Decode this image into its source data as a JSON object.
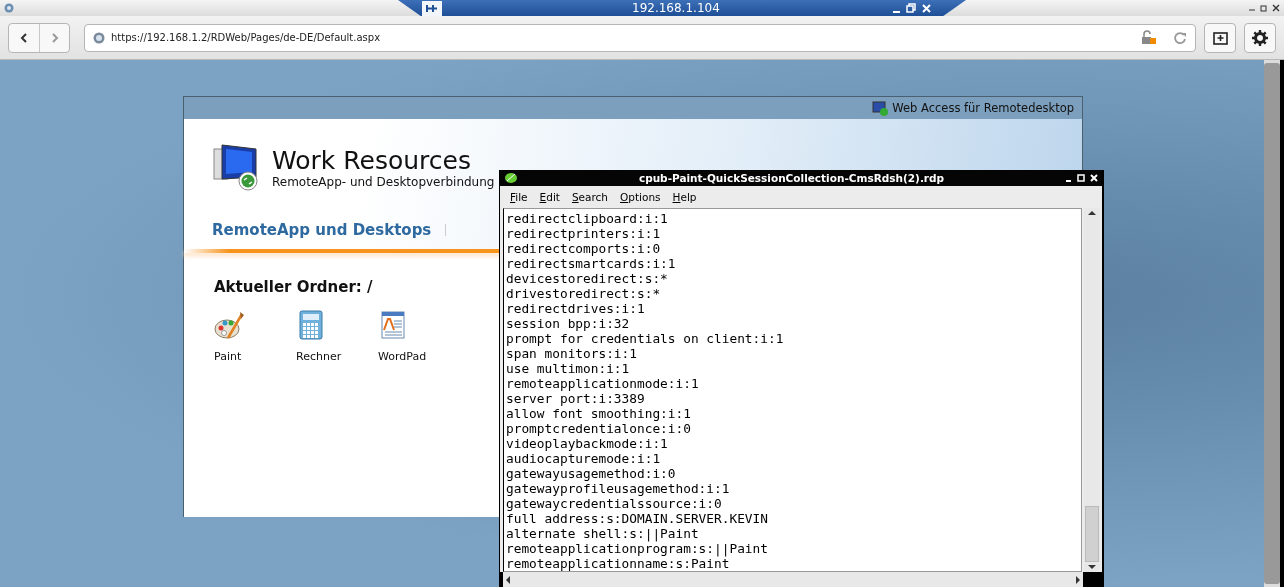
{
  "remote_bar": {
    "address": "192.168.1.104"
  },
  "browser": {
    "url": "https://192.168.1.2/RDWeb/Pages/de-DE/Default.aspx"
  },
  "page": {
    "header": "Web Access für Remotedesktop",
    "title": "Work Resources",
    "subtitle": "RemoteApp- und Desktopverbindung",
    "tabs": [
      {
        "label": "RemoteApp und Desktops",
        "selected": true
      }
    ],
    "folder": "Aktueller Ordner: /",
    "apps": [
      {
        "name": "Paint",
        "kind": "paint"
      },
      {
        "name": "Rechner",
        "kind": "calculator"
      },
      {
        "name": "WordPad",
        "kind": "wordpad"
      }
    ]
  },
  "editor": {
    "title": "cpub-Paint-QuickSessionCollection-CmsRdsh(2).rdp",
    "menu": [
      "File",
      "Edit",
      "Search",
      "Options",
      "Help"
    ],
    "lines": [
      "redirectclipboard:i:1",
      "redirectprinters:i:1",
      "redirectcomports:i:0",
      "redirectsmartcards:i:1",
      "devicestoredirect:s:*",
      "drivestoredirect:s:*",
      "redirectdrives:i:1",
      "session bpp:i:32",
      "prompt for credentials on client:i:1",
      "span monitors:i:1",
      "use multimon:i:1",
      "remoteapplicationmode:i:1",
      "server port:i:3389",
      "allow font smoothing:i:1",
      "promptcredentialonce:i:0",
      "videoplaybackmode:i:1",
      "audiocapturemode:i:1",
      "gatewayusagemethod:i:0",
      "gatewayprofileusagemethod:i:1",
      "gatewaycredentialssource:i:0",
      "full address:s:DOMAIN.SERVER.KEVIN",
      "alternate shell:s:||Paint",
      "remoteapplicationprogram:s:||Paint",
      "remoteapplicationname:s:Paint"
    ]
  }
}
